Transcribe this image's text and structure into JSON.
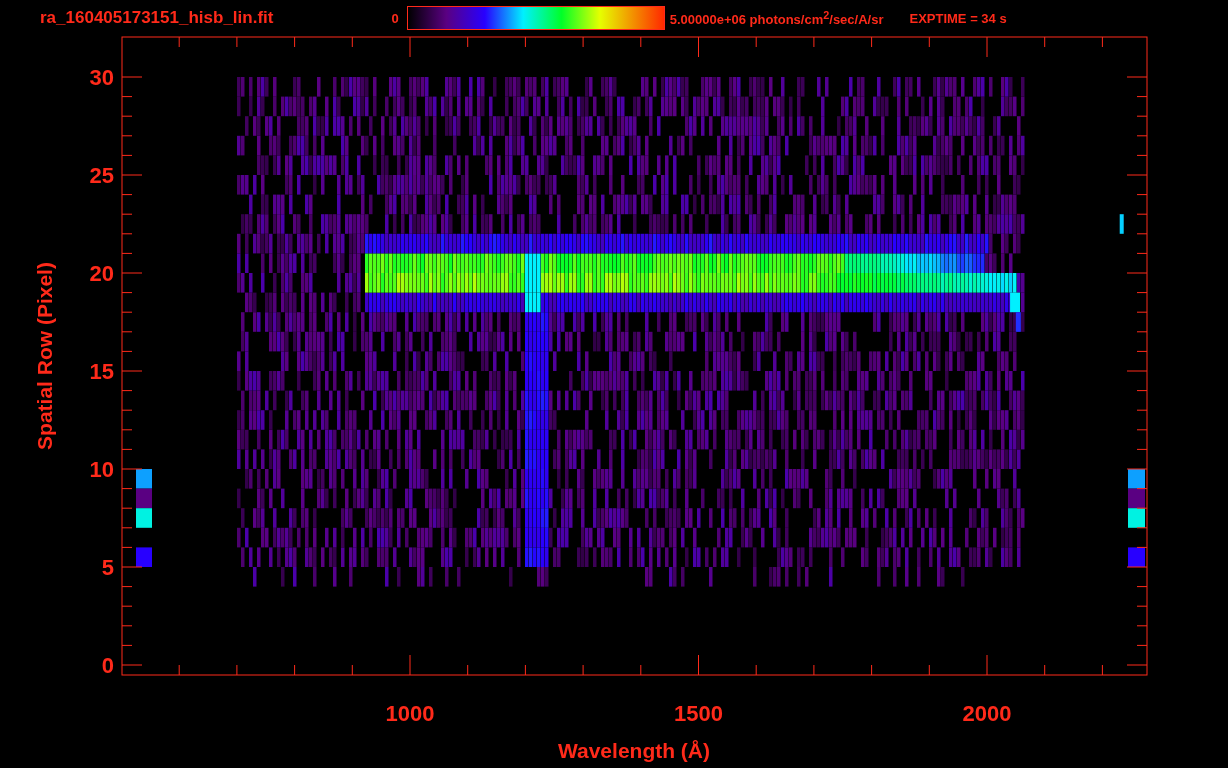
{
  "title": "ra_160405173151_hisb_lin.fit",
  "colorbar": {
    "min_label": "0",
    "max_label": "5.00000e+06 photons/cm$^{2}$/sec/A/sr"
  },
  "exposure": "EXPTIME = 34 s",
  "plot": {
    "ylabel": "Spatial Row (Pixel)",
    "xlabel": "Wavelength (Å)",
    "yticks": [
      "30",
      "25",
      "20",
      "15",
      "10",
      "5",
      "0"
    ],
    "xticks": [
      "1000",
      "1500",
      "2000"
    ]
  }
}
